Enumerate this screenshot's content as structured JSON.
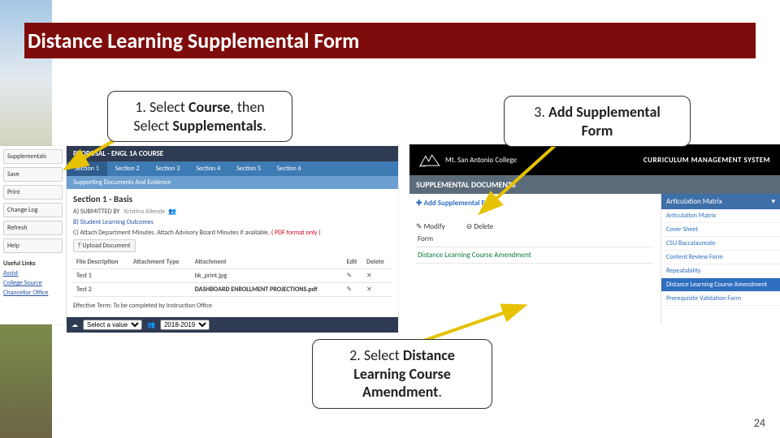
{
  "title": "Distance Learning Supplemental Form",
  "callouts": {
    "c1_pre": "1. Select ",
    "c1_b1": "Course",
    "c1_mid": ", then Select ",
    "c1_b2": "Supplementals",
    "c1_post": ".",
    "c2_pre": "2. Select ",
    "c2_b": "Distance Learning Course Amendment",
    "c2_post": ".",
    "c3_pre": "3. ",
    "c3_b": "Add Supplemental Form"
  },
  "left": {
    "proposal": "PROPOSAL - ENGL 1A COURSE",
    "side_buttons": [
      "Supplementals",
      "Save",
      "Print",
      "Change Log",
      "Refresh",
      "Help"
    ],
    "links_header": "Useful Links",
    "links": [
      "Assist",
      "College Source",
      "Chancellor Office"
    ],
    "tabs": [
      "Section 1",
      "Section 2",
      "Section 3",
      "Section 4",
      "Section 5",
      "Section 6"
    ],
    "subtab": "Supporting Documents And Evidence",
    "section_h": "Section 1 - Basis",
    "a_label": "A) SUBMITTED BY",
    "a_value": "Kristina Allende",
    "b_label": "B) Student Learning Outcomes",
    "c_label": "C) Attach Department Minutes. Attach Advisory Board Minutes if available.",
    "c_pdf": "( PDF format only )",
    "upload": "Upload Document",
    "table": {
      "headers": [
        "File Description",
        "Attachment Type",
        "Attachment",
        "Edit",
        "Delete"
      ],
      "rows": [
        {
          "desc": "Test 1",
          "type": "",
          "att": "bk_print.jpg"
        },
        {
          "desc": "Test 2",
          "type": "",
          "att": "DASHBOARD ENROLLMENT PROJECTIONS.pdf"
        }
      ]
    },
    "eff": "Effective Term: To be completed by Instruction Office",
    "foot_sel1": "Select a value",
    "foot_sel2": "2018-2019"
  },
  "right": {
    "logo_text": "Mt. San Antonio College",
    "cms": "CURRICULUM MANAGEMENT SYSTEM",
    "bar": "SUPPLEMENTAL DOCUMENTS",
    "add": "Add Supplemental Form",
    "modify": "Modify",
    "delete": "Delete",
    "rows": [
      "Form",
      "Distance Learning Course Amendment"
    ],
    "dd_head": "Articulation Matrix",
    "dd_items": [
      "Articulation Matrix",
      "Cover Sheet",
      "CSU Baccalaureate",
      "Content Review Form",
      "Repeatability",
      "Distance Learning Course Amendment",
      "Prerequisite Validation Form"
    ],
    "dd_selected_index": 5
  },
  "page_number": "24"
}
